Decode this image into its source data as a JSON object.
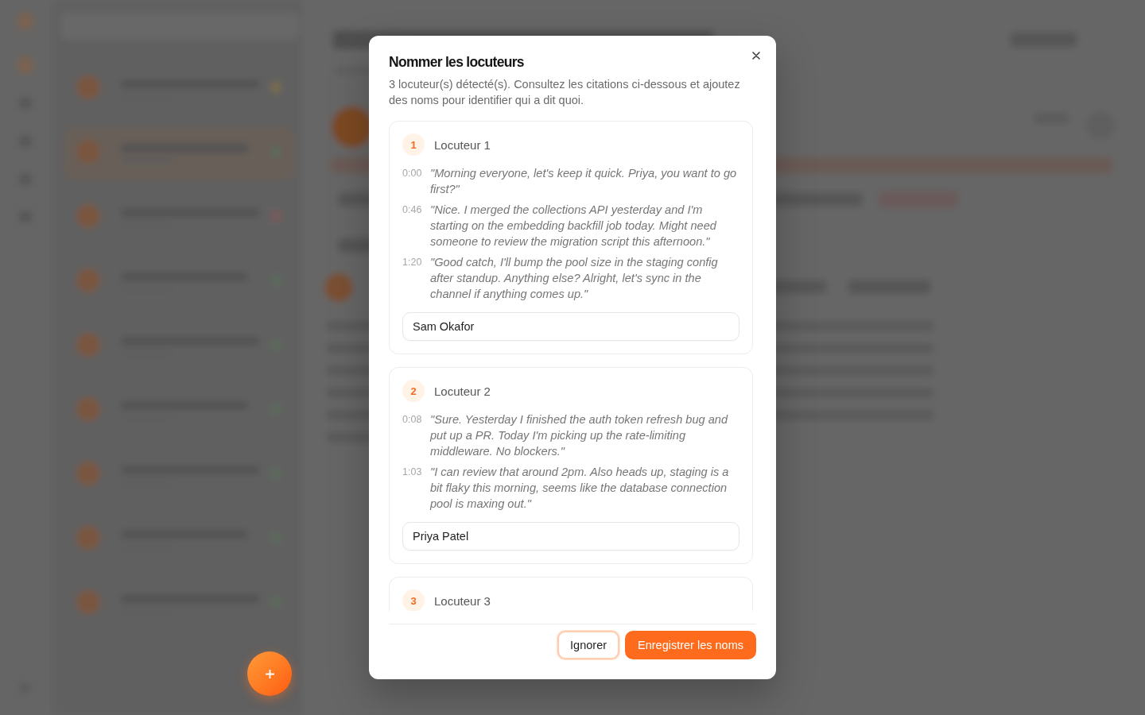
{
  "dialog": {
    "title": "Nommer les locuteurs",
    "description": "3 locuteur(s) détecté(s). Consultez les citations ci-dessous et ajoutez des noms pour identifier qui a dit quoi.",
    "speakers": [
      {
        "number": "1",
        "label": "Locuteur 1",
        "quotes": [
          {
            "time": "0:00",
            "text": "\"Morning everyone, let's keep it quick. Priya, you want to go first?\""
          },
          {
            "time": "0:46",
            "text": "\"Nice. I merged the collections API yesterday and I'm starting on the embedding backfill job today. Might need someone to review the migration script this afternoon.\""
          },
          {
            "time": "1:20",
            "text": "\"Good catch, I'll bump the pool size in the staging config after standup. Anything else? Alright, let's sync in the channel if anything comes up.\""
          }
        ],
        "name": "Sam Okafor"
      },
      {
        "number": "2",
        "label": "Locuteur 2",
        "quotes": [
          {
            "time": "0:08",
            "text": "\"Sure. Yesterday I finished the auth token refresh bug and put up a PR. Today I'm picking up the rate-limiting middleware. No blockers.\""
          },
          {
            "time": "1:03",
            "text": "\"I can review that around 2pm. Also heads up, staging is a bit flaky this morning, seems like the database connection pool is maxing out.\""
          }
        ],
        "name": "Priya Patel"
      },
      {
        "number": "3",
        "label": "Locuteur 3"
      }
    ],
    "buttons": [
      {
        "label": "Ignorer",
        "kind": "secondary",
        "focused": true
      },
      {
        "label": "Enregistrer les noms",
        "kind": "primary",
        "focused": false
      }
    ]
  }
}
